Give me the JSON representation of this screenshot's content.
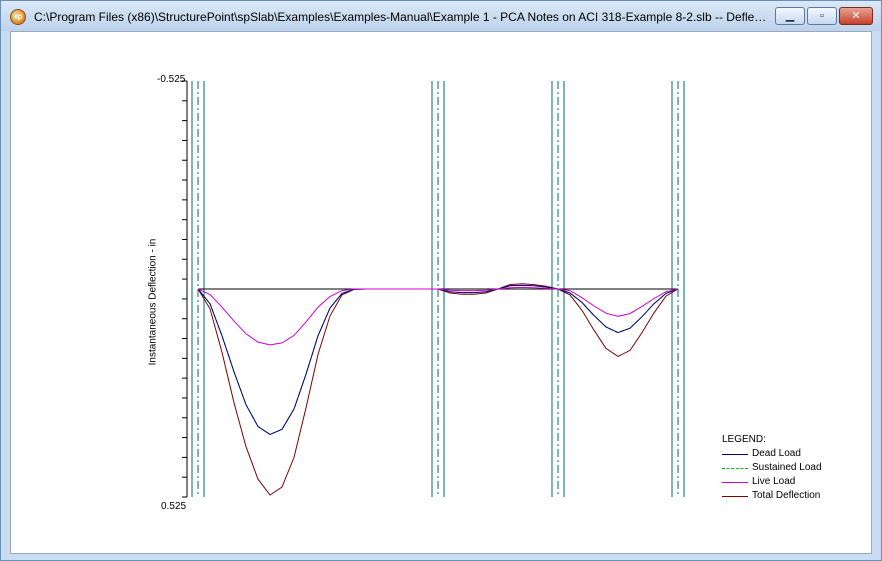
{
  "window": {
    "title": "C:\\Program Files (x86)\\StructurePoint\\spSlab\\Examples\\Examples-Manual\\Example 1 - PCA Notes on ACI 318-Example 8-2.slb -- Deflectio...",
    "icon": "sp-logo-icon",
    "app_icon_text": "sp",
    "minimize_icon": "minimize-icon",
    "maximize_icon": "maximize-icon",
    "close_icon": "close-icon",
    "minimize_glyph": "▁",
    "maximize_glyph": "▫",
    "close_glyph": "✕"
  },
  "chart_data": {
    "type": "line",
    "ylabel": "Instantaneous Deflection - in",
    "ylim": [
      -0.525,
      0.525
    ],
    "y_tick_labels": [
      "-0.525",
      "0.525"
    ],
    "y_minor_ticks": 21,
    "x_unit_note": "span-relative position",
    "x": [
      0,
      0.05,
      0.1,
      0.15,
      0.2,
      0.25,
      0.3,
      0.35,
      0.4,
      0.45,
      0.5,
      0.55,
      0.6,
      0.65,
      0.7,
      0.75,
      0.8,
      0.85,
      0.9,
      0.95,
      1.0,
      1.05,
      1.1,
      1.15,
      1.2,
      1.25,
      1.3,
      1.35,
      1.4,
      1.45,
      1.5,
      1.55,
      1.6,
      1.65,
      1.7,
      1.75,
      1.8,
      1.85,
      1.9,
      1.95,
      2.0
    ],
    "supports": [
      0.0,
      1.0,
      1.5,
      2.0
    ],
    "legend_title": "LEGEND:",
    "legend_position": "bottom-right",
    "series": [
      {
        "name": "Dead Load",
        "color": "#000080",
        "style": "solid",
        "values": [
          0,
          0.037,
          0.118,
          0.209,
          0.292,
          0.347,
          0.367,
          0.354,
          0.303,
          0.215,
          0.118,
          0.048,
          0.011,
          0.001,
          0,
          0,
          0,
          0,
          0,
          0,
          0,
          0.007,
          0.009,
          0.009,
          0.007,
          0,
          -0.008,
          -0.009,
          -0.008,
          -0.005,
          0,
          0.01,
          0.034,
          0.067,
          0.096,
          0.11,
          0.099,
          0.07,
          0.037,
          0.011,
          0
        ]
      },
      {
        "name": "Sustained Load",
        "color": "#00c000",
        "style": "dashed",
        "values": [
          0,
          0.037,
          0.118,
          0.209,
          0.292,
          0.347,
          0.367,
          0.354,
          0.303,
          0.215,
          0.118,
          0.048,
          0.011,
          0.001,
          0,
          0,
          0,
          0,
          0,
          0,
          0,
          0.007,
          0.009,
          0.009,
          0.007,
          0,
          -0.008,
          -0.009,
          -0.008,
          -0.005,
          0,
          0.01,
          0.034,
          0.067,
          0.096,
          0.11,
          0.099,
          0.07,
          0.037,
          0.011,
          0
        ]
      },
      {
        "name": "Live Load",
        "color": "#d000d0",
        "style": "solid",
        "values": [
          0,
          0.014,
          0.046,
          0.081,
          0.113,
          0.134,
          0.141,
          0.136,
          0.117,
          0.083,
          0.046,
          0.019,
          0.004,
          0,
          0,
          0,
          0,
          0,
          0,
          0,
          0,
          0.003,
          0.004,
          0.004,
          0.003,
          0,
          -0.003,
          -0.004,
          -0.003,
          -0.002,
          0,
          0.004,
          0.022,
          0.043,
          0.061,
          0.069,
          0.062,
          0.044,
          0.024,
          0.007,
          0
        ]
      },
      {
        "name": "Total Deflection",
        "color": "#800000",
        "style": "solid",
        "values": [
          0,
          0.05,
          0.16,
          0.287,
          0.398,
          0.48,
          0.52,
          0.5,
          0.425,
          0.3,
          0.165,
          0.068,
          0.015,
          0.001,
          0,
          0,
          0,
          0,
          0,
          0,
          0,
          0.01,
          0.013,
          0.013,
          0.01,
          0,
          -0.011,
          -0.013,
          -0.011,
          -0.007,
          0,
          0.015,
          0.054,
          0.104,
          0.15,
          0.17,
          0.155,
          0.11,
          0.06,
          0.018,
          0
        ]
      }
    ]
  }
}
